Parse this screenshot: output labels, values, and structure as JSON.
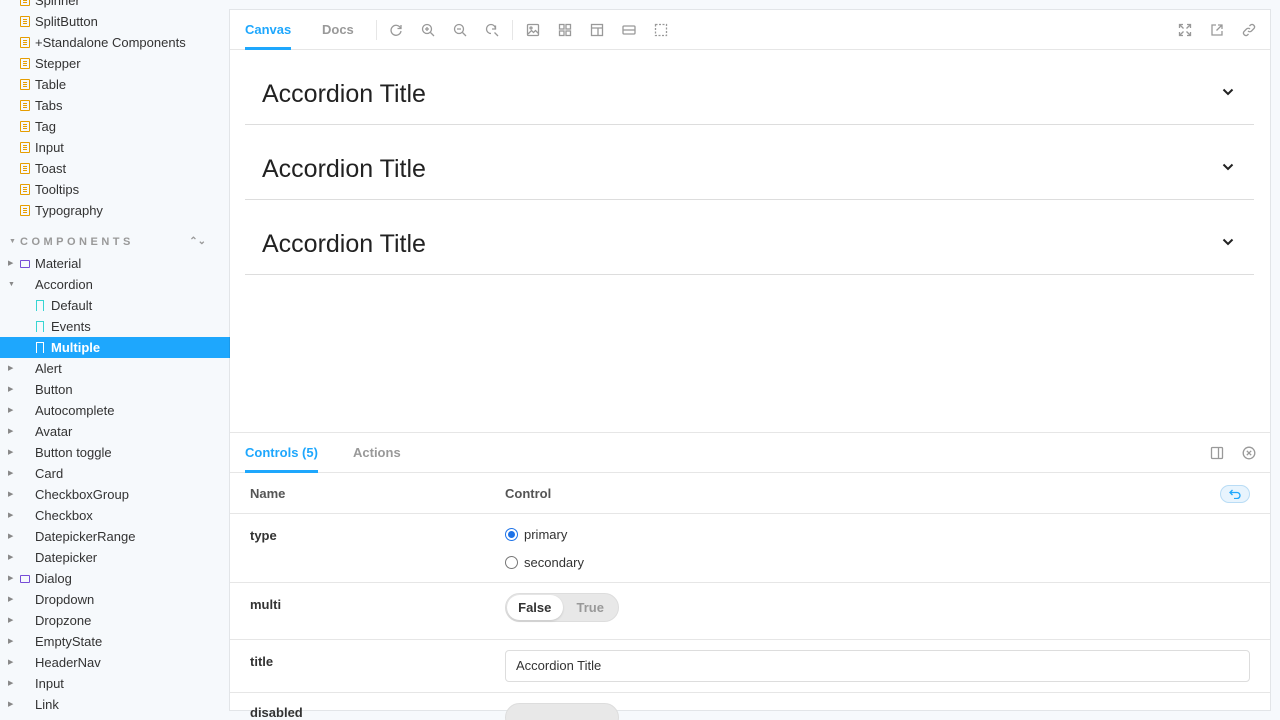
{
  "sidebar": {
    "docs_items": [
      {
        "label": "Spinner"
      },
      {
        "label": "SplitButton"
      },
      {
        "label": "+Standalone Components"
      },
      {
        "label": "Stepper"
      },
      {
        "label": "Table"
      },
      {
        "label": "Tabs"
      },
      {
        "label": "Tag"
      },
      {
        "label": "Input"
      },
      {
        "label": "Toast"
      },
      {
        "label": "Tooltips"
      },
      {
        "label": "Typography"
      }
    ],
    "section_title": "COMPONENTS",
    "component_items": [
      {
        "label": "Material",
        "type": "folder"
      },
      {
        "label": "Accordion",
        "type": "component",
        "expanded": true
      },
      {
        "label": "Default",
        "type": "story"
      },
      {
        "label": "Events",
        "type": "story"
      },
      {
        "label": "Multiple",
        "type": "story",
        "selected": true
      },
      {
        "label": "Alert",
        "type": "component"
      },
      {
        "label": "Button",
        "type": "component"
      },
      {
        "label": "Autocomplete",
        "type": "component"
      },
      {
        "label": "Avatar",
        "type": "component"
      },
      {
        "label": "Button toggle",
        "type": "component"
      },
      {
        "label": "Card",
        "type": "component"
      },
      {
        "label": "CheckboxGroup",
        "type": "component"
      },
      {
        "label": "Checkbox",
        "type": "component"
      },
      {
        "label": "DatepickerRange",
        "type": "component"
      },
      {
        "label": "Datepicker",
        "type": "component"
      },
      {
        "label": "Dialog",
        "type": "folder"
      },
      {
        "label": "Dropdown",
        "type": "component"
      },
      {
        "label": "Dropzone",
        "type": "component"
      },
      {
        "label": "EmptyState",
        "type": "component"
      },
      {
        "label": "HeaderNav",
        "type": "component"
      },
      {
        "label": "Input",
        "type": "component"
      },
      {
        "label": "Link",
        "type": "component"
      }
    ]
  },
  "toolbar": {
    "tab_canvas": "Canvas",
    "tab_docs": "Docs"
  },
  "canvas": {
    "accordions": [
      {
        "title": "Accordion Title"
      },
      {
        "title": "Accordion Title"
      },
      {
        "title": "Accordion Title"
      }
    ]
  },
  "panel": {
    "tab_controls": "Controls (5)",
    "tab_actions": "Actions",
    "col_name": "Name",
    "col_control": "Control",
    "rows": {
      "type": {
        "name": "type",
        "options": [
          "primary",
          "secondary"
        ],
        "selected": "primary"
      },
      "multi": {
        "name": "multi",
        "off_label": "False",
        "on_label": "True",
        "value": "False"
      },
      "title": {
        "name": "title",
        "value": "Accordion Title"
      },
      "disabled": {
        "name": "disabled"
      }
    }
  },
  "colors": {
    "accent": "#1ea7fd",
    "doc_icon": "#e69d00",
    "folder_icon": "#774dd7",
    "story_icon": "#37d5d3"
  }
}
